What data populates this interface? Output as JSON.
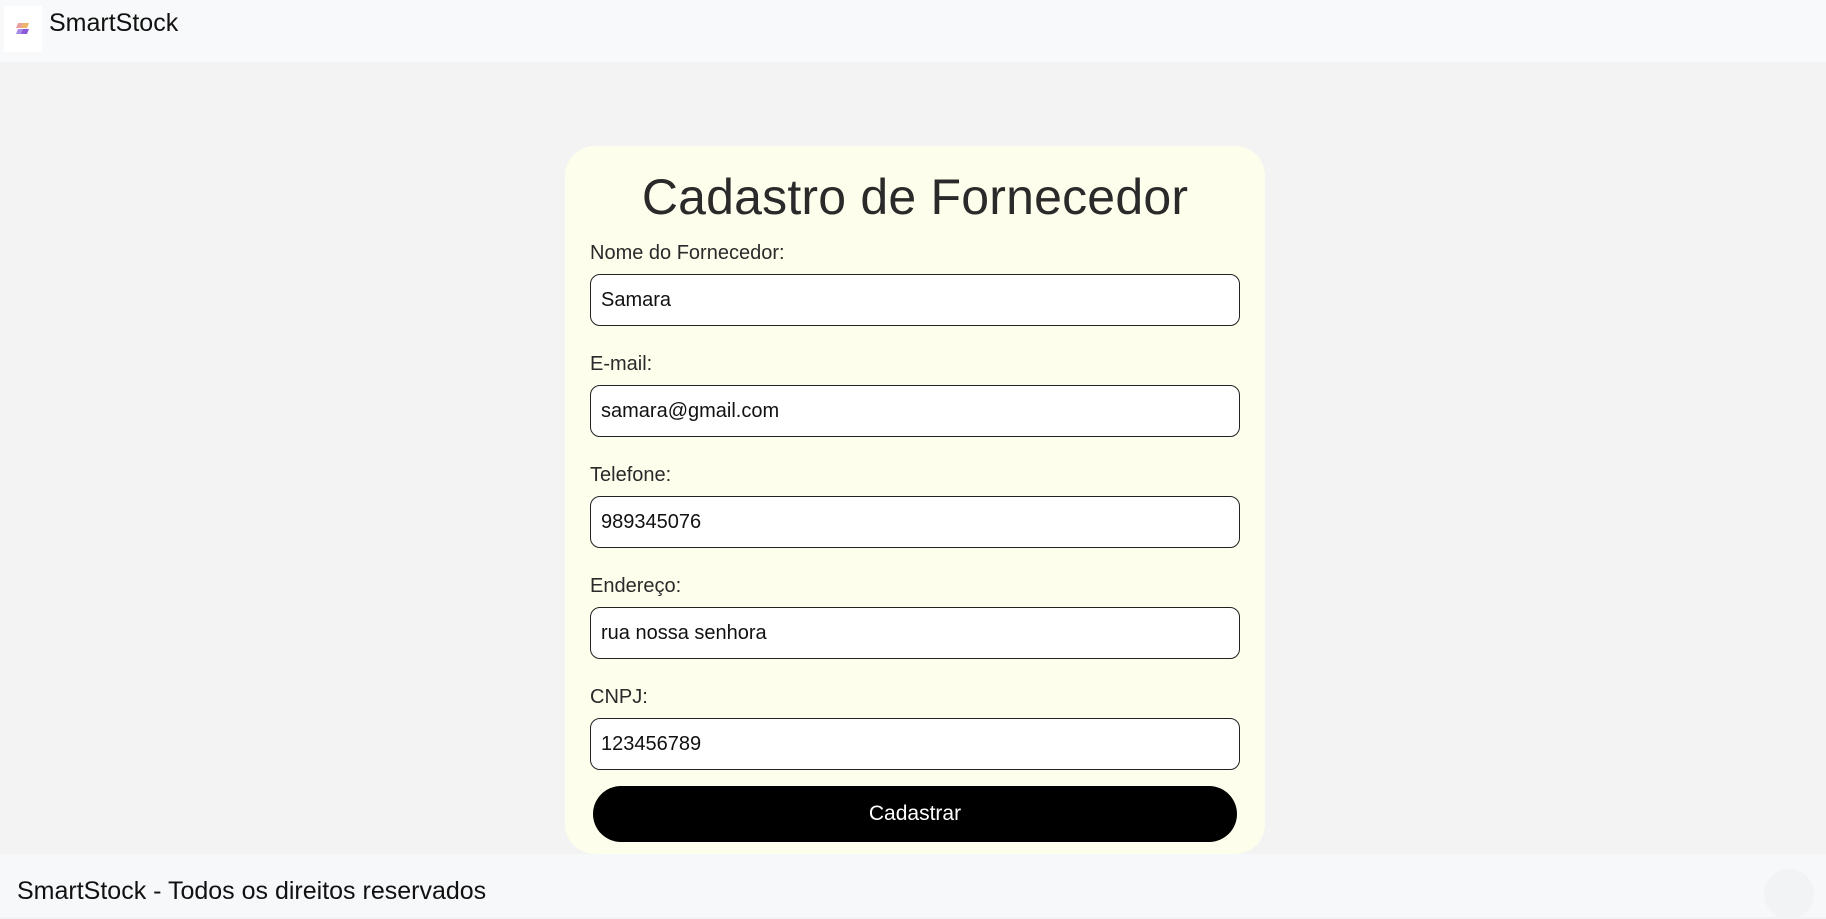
{
  "navbar": {
    "brand_name": "SmartStock",
    "logo_icon": "smartstock-logo-icon"
  },
  "form": {
    "title": "Cadastro de Fornecedor",
    "fields": [
      {
        "label": "Nome do Fornecedor:",
        "value": "Samara"
      },
      {
        "label": "E-mail:",
        "value": "samara@gmail.com"
      },
      {
        "label": "Telefone:",
        "value": "989345076"
      },
      {
        "label": "Endereço:",
        "value": "rua nossa senhora"
      },
      {
        "label": "CNPJ:",
        "value": "123456789"
      }
    ],
    "submit_label": "Cadastrar"
  },
  "footer": {
    "text": "SmartStock - Todos os direitos reservados"
  },
  "colors": {
    "page_bg": "#f3f3f3",
    "card_bg": "#fefeec",
    "button_bg": "#000000",
    "button_text": "#ffffff"
  }
}
